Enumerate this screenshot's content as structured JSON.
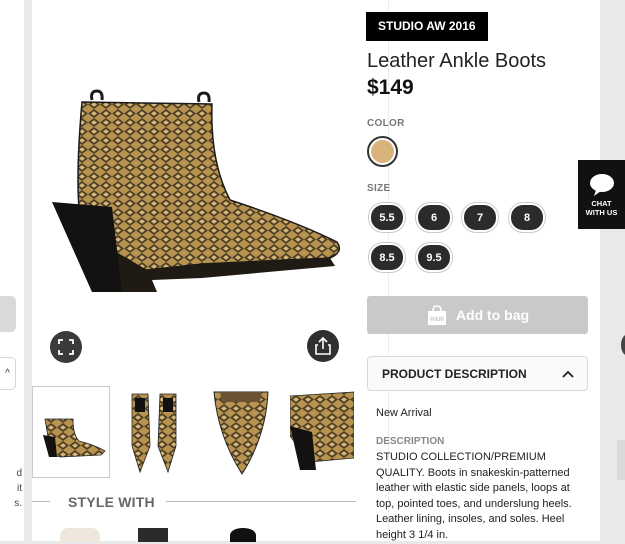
{
  "left_partial": {
    "text": "d\nit\ns.",
    "chevron": "^"
  },
  "product": {
    "badge": "STUDIO AW 2016",
    "title": "Leather Ankle Boots",
    "price": "$149"
  },
  "color": {
    "label": "COLOR",
    "selected_swatch": "#d8b37c"
  },
  "size": {
    "label": "SIZE",
    "options": [
      "5.5",
      "6",
      "7",
      "8",
      "8.5",
      "9.5"
    ]
  },
  "add_to_bag": {
    "label": "Add to bag",
    "icon_text": "H&M"
  },
  "product_description": {
    "header": "PRODUCT DESCRIPTION",
    "new_arrival": "New Arrival",
    "description_label": "DESCRIPTION",
    "description": "STUDIO COLLECTION/PREMIUM QUALITY. Boots in snakeskin-patterned leather with elastic side panels, loops at top, pointed toes, and underslung heels. Leather lining, insoles, and soles. Heel height 3 1/4 in."
  },
  "gallery": {
    "style_with_label": "STYLE WITH",
    "thumbnails": [
      "side-view",
      "pair-top-view",
      "toe-view",
      "heel-closeup"
    ],
    "selected_index": 0
  },
  "chat": {
    "label": "CHAT\nWITH US"
  },
  "icons": {
    "expand": "expand-icon",
    "share": "share-icon",
    "chat": "chat-bubble-icon",
    "chevron_up": "chevron-up-icon",
    "bag": "shopping-bag-icon"
  },
  "colors": {
    "brand_black": "#000000",
    "button_disabled": "#c9c9c9",
    "snakeskin_tan": "#b8924f"
  }
}
